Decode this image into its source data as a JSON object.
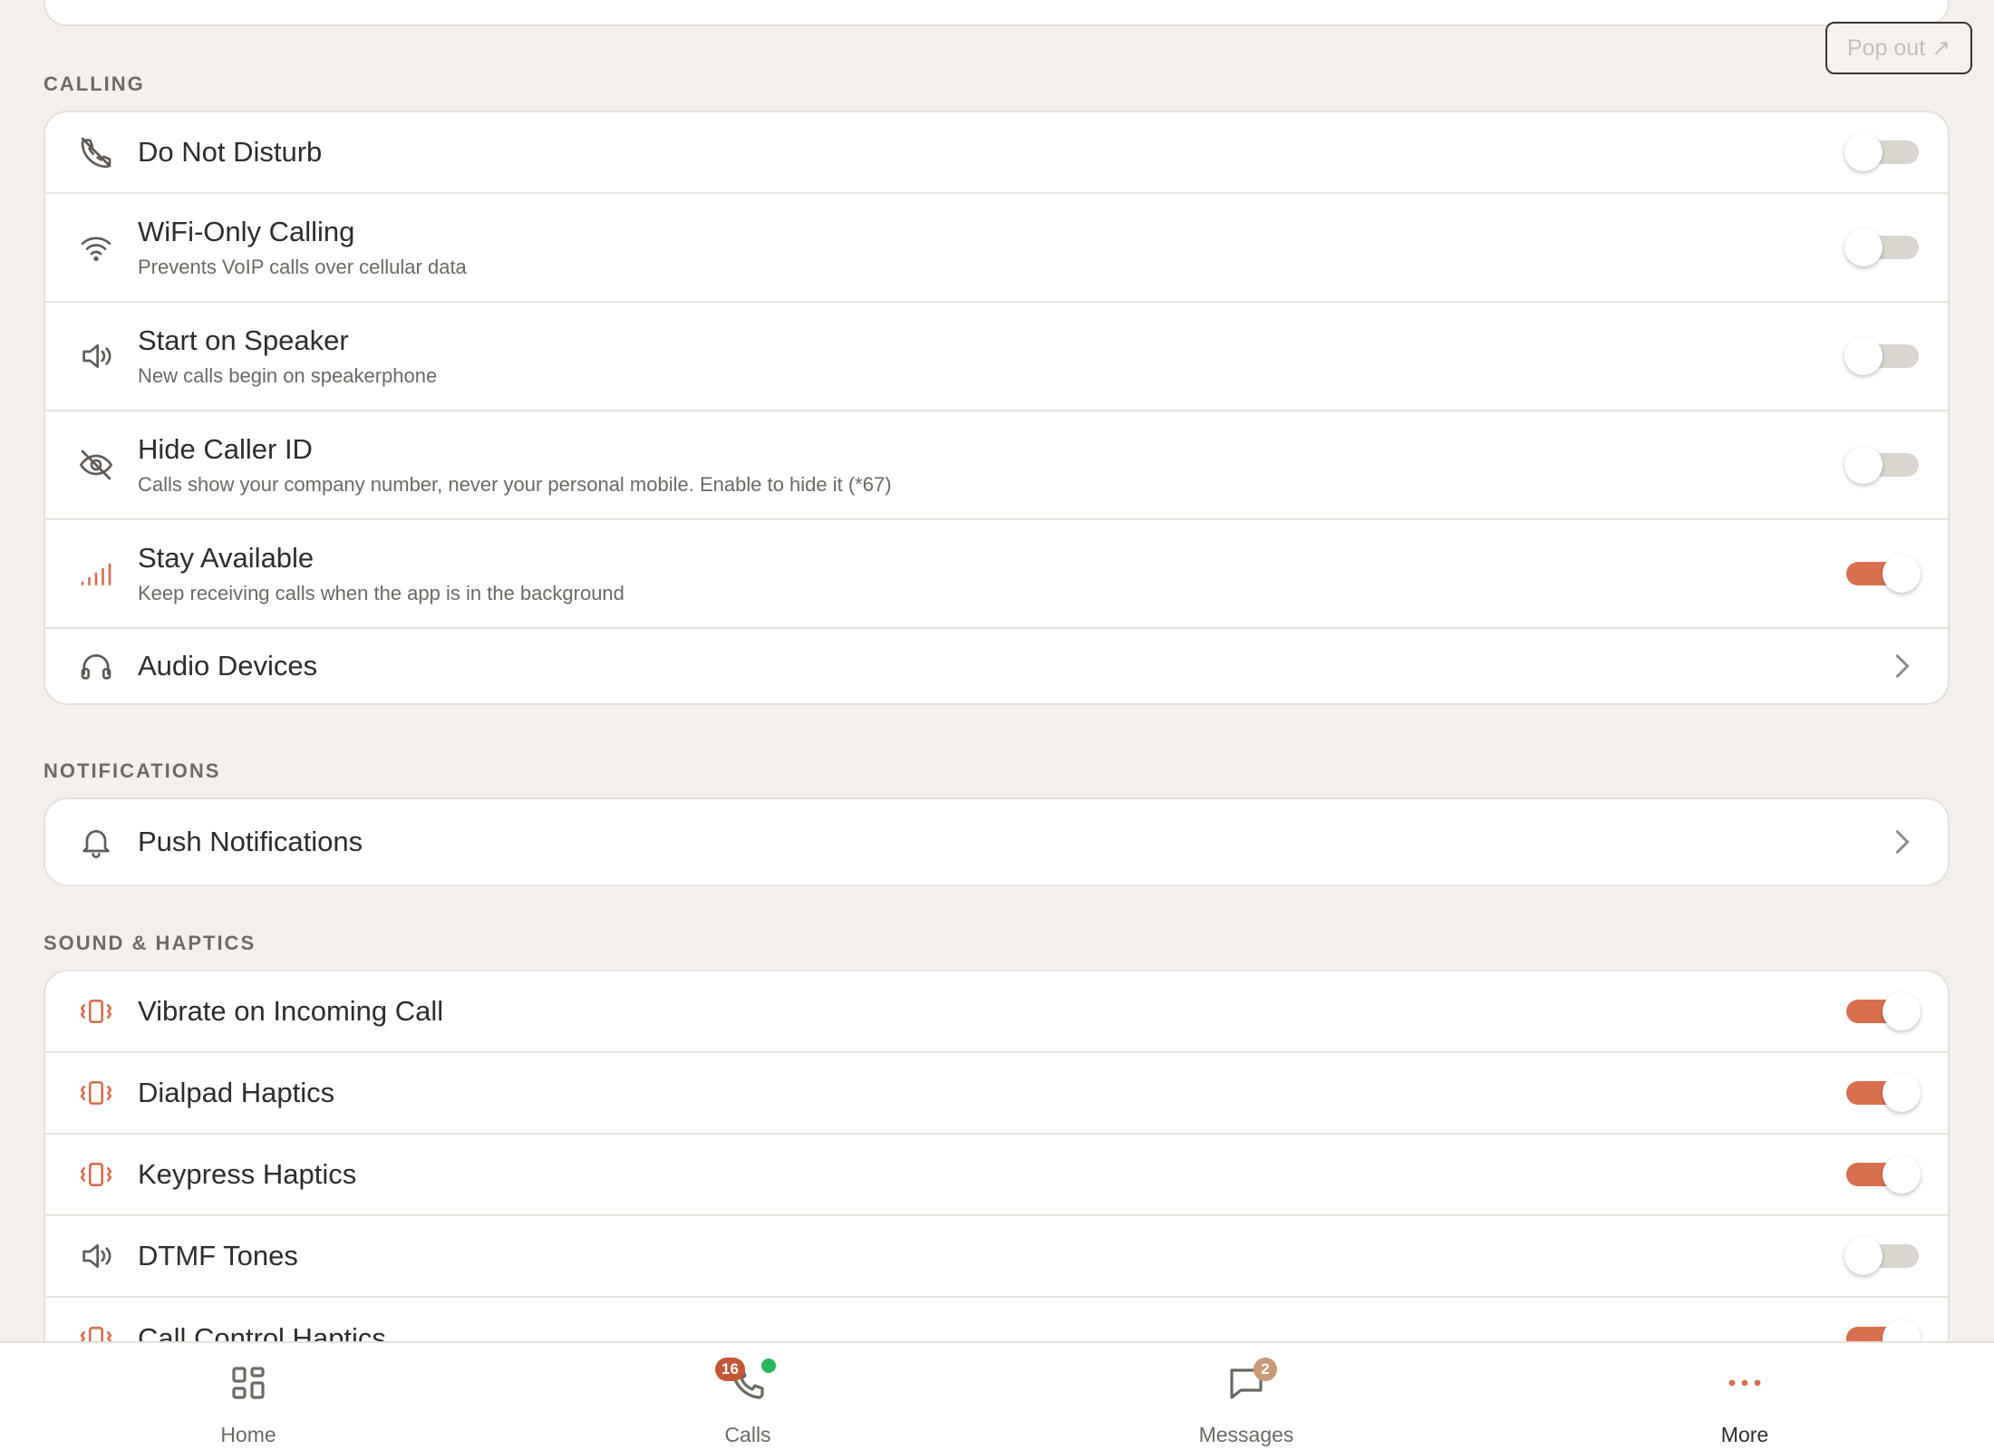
{
  "colors": {
    "accent": "#d86f4f",
    "background": "#f4f1ec",
    "card": "#ffffff",
    "toggle_off": "#d9d5cf",
    "online": "#27b65b"
  },
  "popout_label": "Pop out ↗",
  "calling": {
    "title": "CALLING",
    "rows": [
      {
        "label": "Do Not Disturb",
        "icon": "phone-off-icon",
        "toggle": false
      },
      {
        "label": "WiFi-Only Calling",
        "sub": "Prevents VoIP calls over cellular data",
        "icon": "wifi-icon",
        "toggle": false
      },
      {
        "label": "Start on Speaker",
        "sub": "New calls begin on speakerphone",
        "icon": "speaker-icon",
        "toggle": false
      },
      {
        "label": "Hide Caller ID",
        "sub": "Calls show your company number, never your personal mobile. Enable to hide it (*67)",
        "icon": "eye-off-icon",
        "toggle": false
      },
      {
        "label": "Stay Available",
        "sub": "Keep receiving calls when the app is in the background",
        "icon": "signal-bars-icon",
        "toggle": true
      },
      {
        "label": "Audio Devices",
        "icon": "headphones-icon",
        "chevron": true
      }
    ]
  },
  "notifications": {
    "title": "NOTIFICATIONS",
    "rows": [
      {
        "label": "Push Notifications",
        "icon": "bell-icon",
        "chevron": true
      }
    ]
  },
  "sound_haptics": {
    "title": "SOUND & HAPTICS",
    "rows": [
      {
        "label": "Vibrate on Incoming Call",
        "icon": "vibrate-icon",
        "toggle": true
      },
      {
        "label": "Dialpad Haptics",
        "icon": "vibrate-icon",
        "toggle": true
      },
      {
        "label": "Keypress Haptics",
        "icon": "vibrate-icon",
        "toggle": true
      },
      {
        "label": "DTMF Tones",
        "icon": "speaker-icon",
        "toggle": false
      },
      {
        "label": "Call Control Haptics",
        "icon": "vibrate-icon",
        "toggle": true
      }
    ]
  },
  "tabbar": {
    "tabs": [
      {
        "label": "Home",
        "icon": "grid-icon"
      },
      {
        "label": "Calls",
        "icon": "phone-icon",
        "badge": "16"
      },
      {
        "label": "Messages",
        "icon": "chat-bubble-icon",
        "badge": "2"
      },
      {
        "label": "More",
        "icon": "more-dots-icon",
        "active": true
      }
    ]
  }
}
